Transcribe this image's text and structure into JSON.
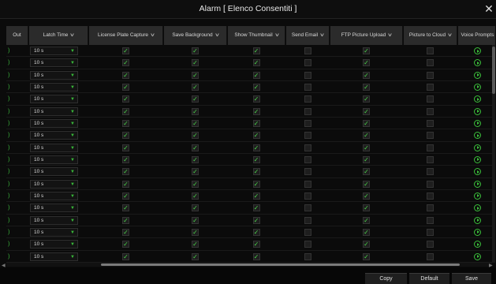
{
  "window": {
    "title": "Alarm [ Elenco Consentiti ]",
    "close_glyph": "✕"
  },
  "columns": [
    {
      "label": "Out",
      "chevron": false
    },
    {
      "label": "Latch Time",
      "chevron": true
    },
    {
      "label": "License Plate Capture",
      "chevron": true
    },
    {
      "label": "Save Background",
      "chevron": true
    },
    {
      "label": "Show Thumbnail",
      "chevron": true
    },
    {
      "label": "Send Email",
      "chevron": true
    },
    {
      "label": "FTP Picture Upload",
      "chevron": true
    },
    {
      "label": "Picture to Cloud",
      "chevron": true
    },
    {
      "label": "Voice Prompts",
      "chevron": false
    }
  ],
  "rows": [
    {
      "lead": ")",
      "latch_time": "10 s",
      "license_plate_capture": true,
      "save_background": true,
      "show_thumbnail": true,
      "send_email": false,
      "ftp_picture_upload": true,
      "picture_to_cloud": false,
      "voice_prompts": "play-icon"
    },
    {
      "lead": ")",
      "latch_time": "10 s",
      "license_plate_capture": true,
      "save_background": true,
      "show_thumbnail": true,
      "send_email": false,
      "ftp_picture_upload": true,
      "picture_to_cloud": false,
      "voice_prompts": "play-icon"
    },
    {
      "lead": ")",
      "latch_time": "10 s",
      "license_plate_capture": true,
      "save_background": true,
      "show_thumbnail": true,
      "send_email": false,
      "ftp_picture_upload": true,
      "picture_to_cloud": false,
      "voice_prompts": "play-icon"
    },
    {
      "lead": ")",
      "latch_time": "10 s",
      "license_plate_capture": true,
      "save_background": true,
      "show_thumbnail": true,
      "send_email": false,
      "ftp_picture_upload": true,
      "picture_to_cloud": false,
      "voice_prompts": "play-icon"
    },
    {
      "lead": ")",
      "latch_time": "10 s",
      "license_plate_capture": true,
      "save_background": true,
      "show_thumbnail": true,
      "send_email": false,
      "ftp_picture_upload": true,
      "picture_to_cloud": false,
      "voice_prompts": "play-icon"
    },
    {
      "lead": ")",
      "latch_time": "10 s",
      "license_plate_capture": true,
      "save_background": true,
      "show_thumbnail": true,
      "send_email": false,
      "ftp_picture_upload": true,
      "picture_to_cloud": false,
      "voice_prompts": "play-icon"
    },
    {
      "lead": ")",
      "latch_time": "10 s",
      "license_plate_capture": true,
      "save_background": true,
      "show_thumbnail": true,
      "send_email": false,
      "ftp_picture_upload": true,
      "picture_to_cloud": false,
      "voice_prompts": "play-icon"
    },
    {
      "lead": ")",
      "latch_time": "10 s",
      "license_plate_capture": true,
      "save_background": true,
      "show_thumbnail": true,
      "send_email": false,
      "ftp_picture_upload": true,
      "picture_to_cloud": false,
      "voice_prompts": "play-icon"
    },
    {
      "lead": ")",
      "latch_time": "10 s",
      "license_plate_capture": true,
      "save_background": true,
      "show_thumbnail": true,
      "send_email": false,
      "ftp_picture_upload": true,
      "picture_to_cloud": false,
      "voice_prompts": "play-icon"
    },
    {
      "lead": ")",
      "latch_time": "10 s",
      "license_plate_capture": true,
      "save_background": true,
      "show_thumbnail": true,
      "send_email": false,
      "ftp_picture_upload": true,
      "picture_to_cloud": false,
      "voice_prompts": "play-icon"
    },
    {
      "lead": ")",
      "latch_time": "10 s",
      "license_plate_capture": true,
      "save_background": true,
      "show_thumbnail": true,
      "send_email": false,
      "ftp_picture_upload": true,
      "picture_to_cloud": false,
      "voice_prompts": "play-icon"
    },
    {
      "lead": ")",
      "latch_time": "10 s",
      "license_plate_capture": true,
      "save_background": true,
      "show_thumbnail": true,
      "send_email": false,
      "ftp_picture_upload": true,
      "picture_to_cloud": false,
      "voice_prompts": "play-icon"
    },
    {
      "lead": ")",
      "latch_time": "10 s",
      "license_plate_capture": true,
      "save_background": true,
      "show_thumbnail": true,
      "send_email": false,
      "ftp_picture_upload": true,
      "picture_to_cloud": false,
      "voice_prompts": "play-icon"
    },
    {
      "lead": ")",
      "latch_time": "10 s",
      "license_plate_capture": true,
      "save_background": true,
      "show_thumbnail": true,
      "send_email": false,
      "ftp_picture_upload": true,
      "picture_to_cloud": false,
      "voice_prompts": "play-icon"
    },
    {
      "lead": ")",
      "latch_time": "10 s",
      "license_plate_capture": true,
      "save_background": true,
      "show_thumbnail": true,
      "send_email": false,
      "ftp_picture_upload": true,
      "picture_to_cloud": false,
      "voice_prompts": "play-icon"
    },
    {
      "lead": ")",
      "latch_time": "10 s",
      "license_plate_capture": true,
      "save_background": true,
      "show_thumbnail": true,
      "send_email": false,
      "ftp_picture_upload": true,
      "picture_to_cloud": false,
      "voice_prompts": "play-icon"
    },
    {
      "lead": ")",
      "latch_time": "10 s",
      "license_plate_capture": true,
      "save_background": true,
      "show_thumbnail": true,
      "send_email": false,
      "ftp_picture_upload": true,
      "picture_to_cloud": false,
      "voice_prompts": "play-icon"
    },
    {
      "lead": ")",
      "latch_time": "10 s",
      "license_plate_capture": true,
      "save_background": true,
      "show_thumbnail": true,
      "send_email": false,
      "ftp_picture_upload": true,
      "picture_to_cloud": false,
      "voice_prompts": "play-icon"
    }
  ],
  "footer": {
    "copy_label": "Copy",
    "default_label": "Default",
    "save_label": "Save"
  },
  "colors": {
    "accent": "#3fbf3f",
    "header_bg": "#2b2b2b",
    "background": "#0b0b0b"
  },
  "icons": {
    "check": "checkmark-icon",
    "dropdown": "dropdown-arrow-icon",
    "play": "play-icon",
    "chevron": "chevron-down-icon"
  }
}
